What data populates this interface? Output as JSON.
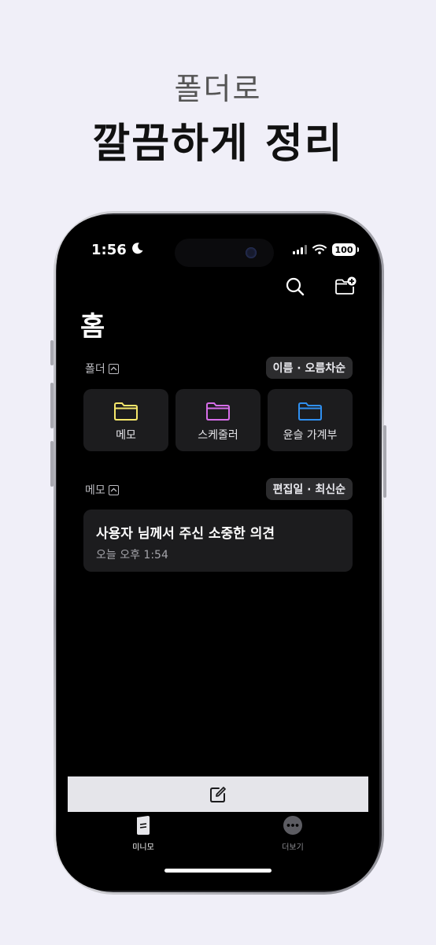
{
  "headline": {
    "sub": "폴더로",
    "main": "깔끔하게 정리"
  },
  "status_bar": {
    "time": "1:56",
    "battery": "100"
  },
  "toolbar": {
    "search_icon": "search-icon",
    "new_folder_icon": "folder-plus-icon"
  },
  "page": {
    "title": "홈"
  },
  "folders": {
    "label": "폴더",
    "sort": "이름 · 오름차순",
    "items": [
      {
        "name": "메모",
        "color": "#f5e66a"
      },
      {
        "name": "스케줄러",
        "color": "#d66de8"
      },
      {
        "name": "윤슬 가계부",
        "color": "#2f8ff0"
      }
    ]
  },
  "memos": {
    "label": "메모",
    "sort": "편집일 · 최신순",
    "items": [
      {
        "title": "사용자 님께서 주신 소중한 의견",
        "date": "오늘 오후 1:54"
      }
    ]
  },
  "compose": {
    "icon": "compose-icon"
  },
  "tabs": [
    {
      "label": "미니모",
      "icon": "notes-icon",
      "active": true
    },
    {
      "label": "더보기",
      "icon": "more-icon",
      "active": false
    }
  ]
}
